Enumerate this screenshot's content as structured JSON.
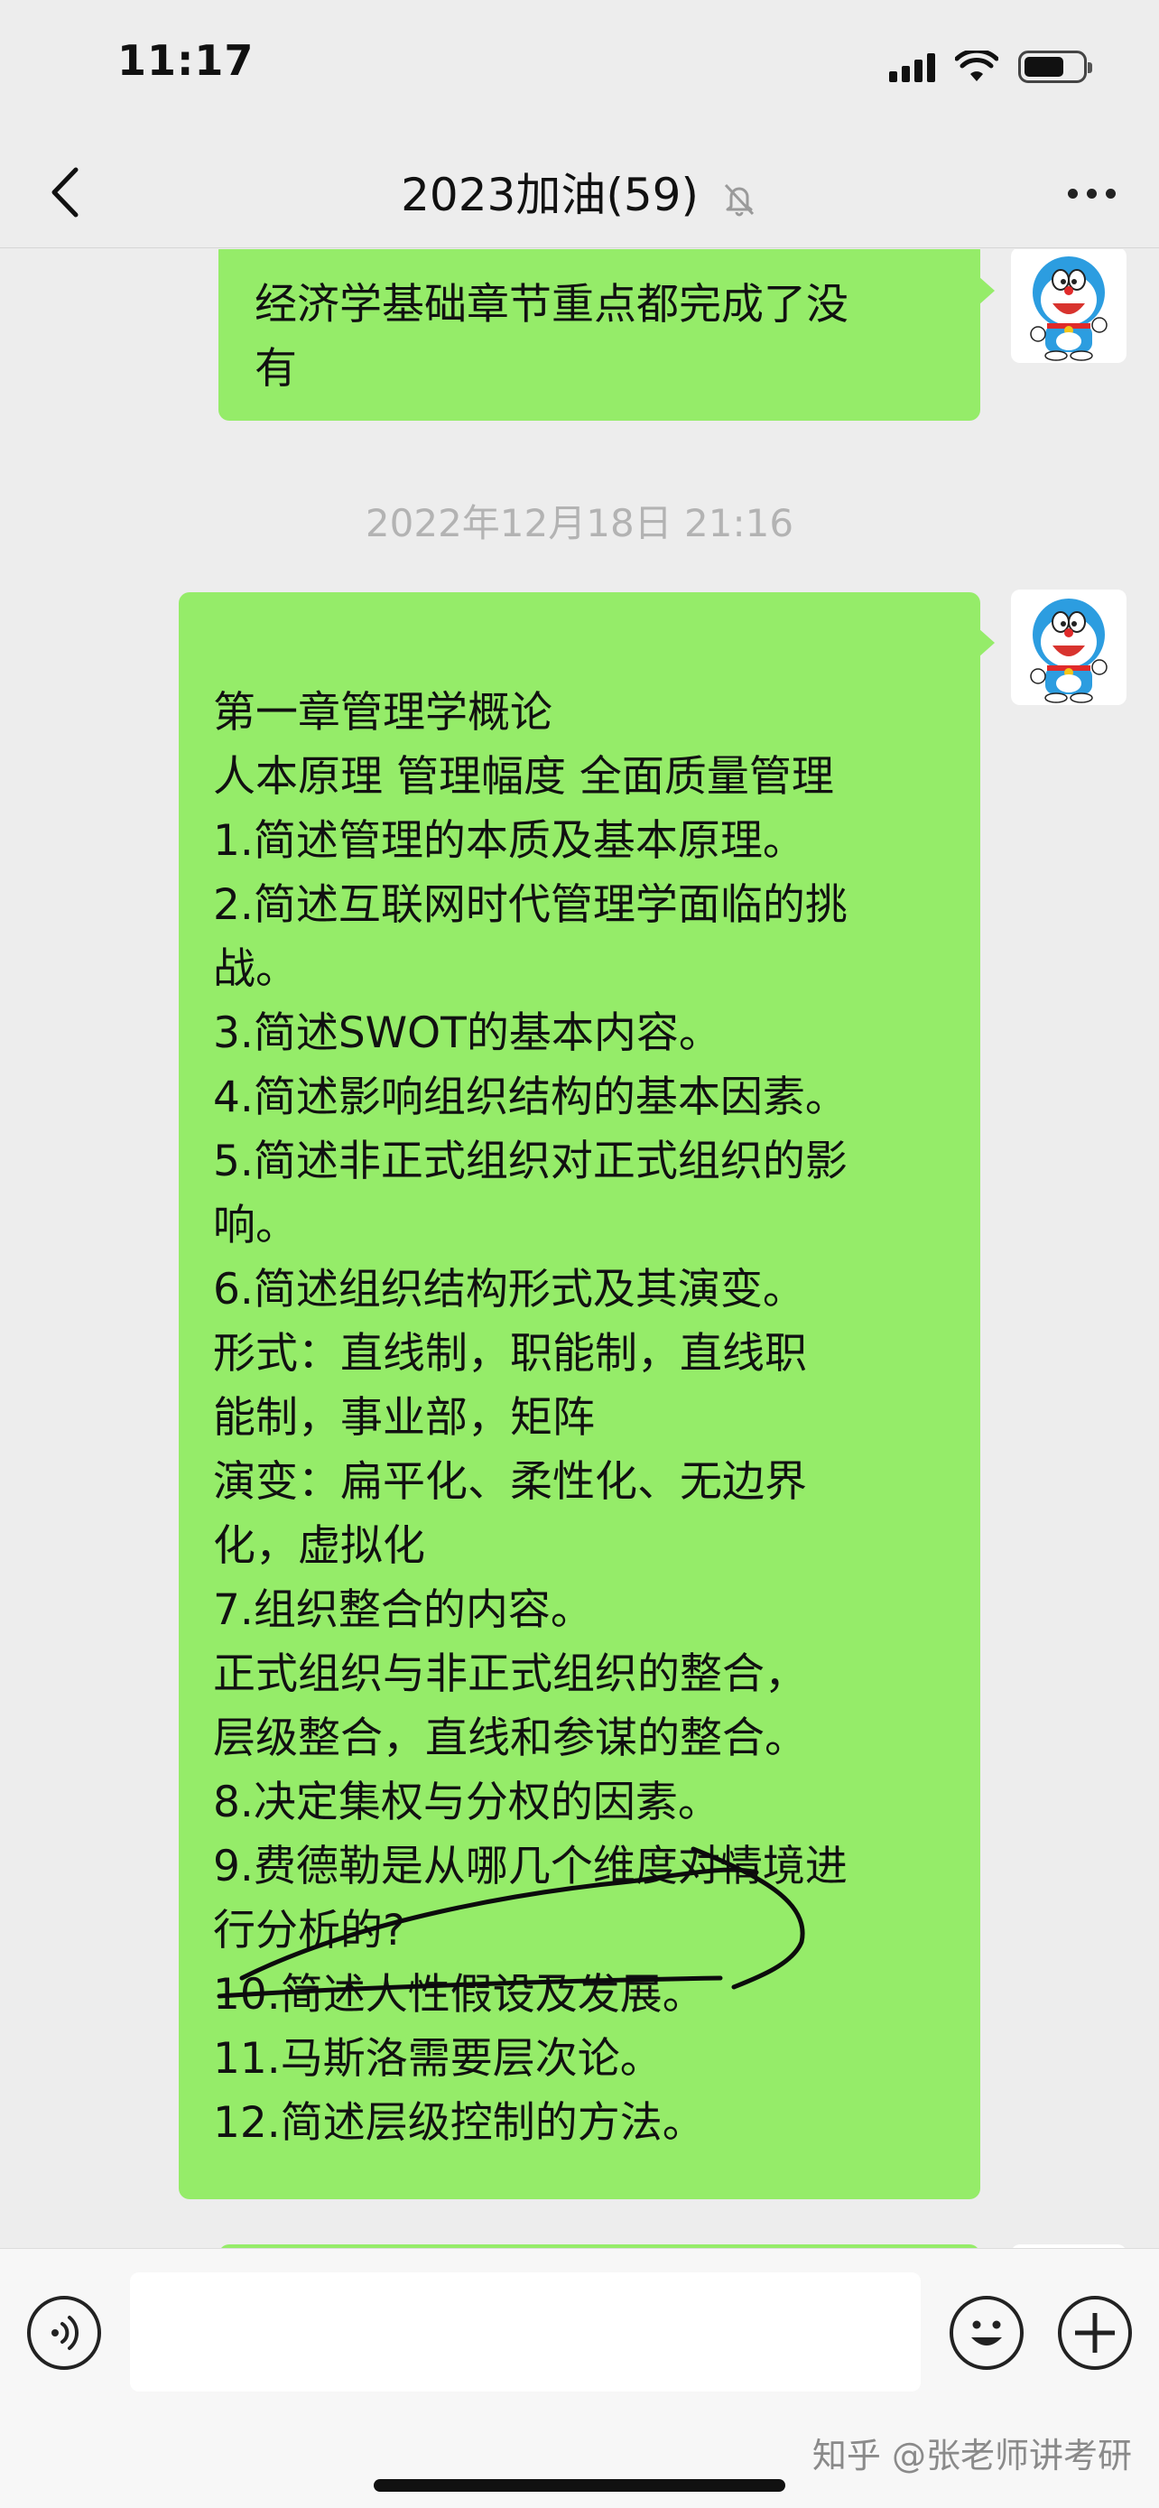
{
  "status_bar": {
    "time": "11:17"
  },
  "nav": {
    "title": "2023加油(59)",
    "muted": true
  },
  "messages": [
    {
      "id": "m1",
      "from": "me",
      "lines": [
        "经济学基础章节重点都完成了没",
        "有"
      ]
    },
    {
      "id": "ts",
      "type": "timestamp",
      "text": "2022年12月18日 21:16"
    },
    {
      "id": "m2",
      "from": "me",
      "lines": [
        "第一章管理学概论",
        "人本原理 管理幅度 全面质量管理",
        "1.简述管理的本质及基本原理。",
        "2.简述互联网时代管理学面临的挑",
        "战。",
        "3.简述SWOT的基本内容。",
        "4.简述影响组织结构的基本因素。",
        "5.简述非正式组织对正式组织的影",
        "响。",
        "6.简述组织结构形式及其演变。",
        "形式：直线制，职能制，直线职",
        "能制，事业部，矩阵",
        "演变：扁平化、柔性化、无边界",
        "化，虚拟化",
        "7.组织整合的内容。",
        "正式组织与非正式组织的整合，",
        "层级整合，直线和参谋的整合。",
        "8.决定集权与分权的因素。",
        "9.费德勒是从哪几个维度对情境进",
        "行分析的?",
        "10.简述人性假设及发展。",
        "11.马斯洛需要层次论。",
        "12.简述层级控制的方法。"
      ]
    }
  ],
  "input": {
    "value": "",
    "placeholder": ""
  },
  "watermark": "知乎 @张老师讲考研",
  "colors": {
    "bubble": "#95ec69",
    "background": "#ededed",
    "timestamp": "#b3b3b3"
  }
}
